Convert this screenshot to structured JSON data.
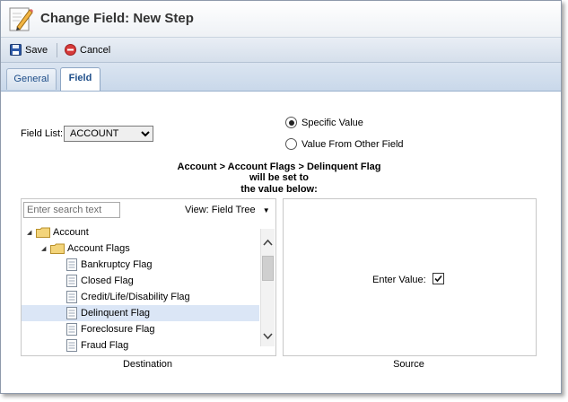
{
  "window": {
    "title": "Change Field: New Step"
  },
  "toolbar": {
    "save_label": "Save",
    "cancel_label": "Cancel"
  },
  "tabs": [
    {
      "label": "General",
      "active": false
    },
    {
      "label": "Field",
      "active": true
    }
  ],
  "form": {
    "field_list_label": "Field List:",
    "field_list_value": "ACCOUNT",
    "radio_specific": "Specific Value",
    "radio_other": "Value From Other Field",
    "radio_selected": "Specific Value",
    "path_line1": "Account > Account Flags > Delinquent Flag",
    "path_line2": "will be set to",
    "path_line3": "the value below:"
  },
  "destination": {
    "search_placeholder": "Enter search text",
    "view_label": "View: Field Tree",
    "caption": "Destination",
    "tree": [
      {
        "label": "Account",
        "type": "folder",
        "level": 0
      },
      {
        "label": "Account Flags",
        "type": "folder",
        "level": 1
      },
      {
        "label": "Bankruptcy Flag",
        "type": "field",
        "level": 2
      },
      {
        "label": "Closed Flag",
        "type": "field",
        "level": 2
      },
      {
        "label": "Credit/Life/Disability Flag",
        "type": "field",
        "level": 2
      },
      {
        "label": "Delinquent Flag",
        "type": "field",
        "level": 2,
        "selected": true
      },
      {
        "label": "Foreclosure Flag",
        "type": "field",
        "level": 2
      },
      {
        "label": "Fraud Flag",
        "type": "field",
        "level": 2
      }
    ]
  },
  "source": {
    "enter_value_label": "Enter Value:",
    "enter_value_checked": true,
    "caption": "Source"
  },
  "colors": {
    "tab_text": "#1f4f8a",
    "selection": "#dbe6f6",
    "folder": "#f3d47a"
  },
  "icons": [
    "edit-pencil-icon",
    "save-disk-icon",
    "cancel-icon",
    "dropdown-arrow-icon",
    "expand-triangle-icon",
    "folder-icon",
    "document-icon",
    "scroll-up-icon",
    "scroll-down-icon",
    "checkmark-icon"
  ]
}
